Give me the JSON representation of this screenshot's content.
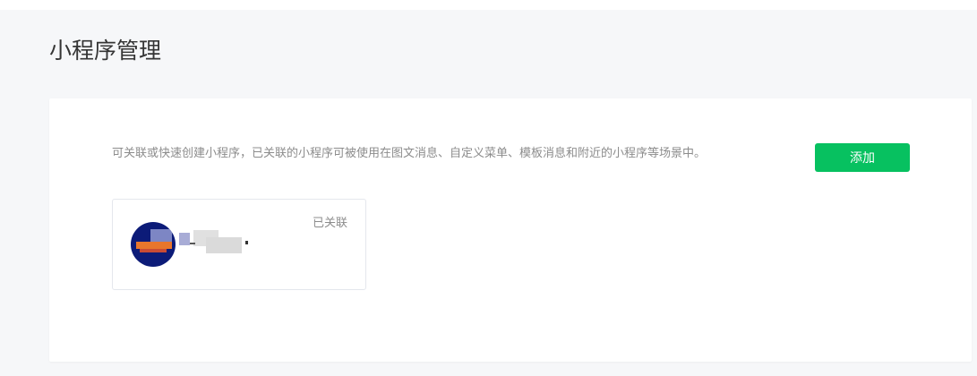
{
  "page": {
    "title": "小程序管理"
  },
  "panel": {
    "description": "可关联或快速创建小程序，已关联的小程序可被使用在图文消息、自定义菜单、模板消息和附近的小程序等场景中。",
    "add_button_label": "添加"
  },
  "miniapps": [
    {
      "status": "已关联",
      "name_redacted": true
    }
  ],
  "colors": {
    "accent": "#07c160",
    "background": "#f6f7f9",
    "panel": "#ffffff",
    "muted_text": "#8c8c8c",
    "title_text": "#353535"
  }
}
